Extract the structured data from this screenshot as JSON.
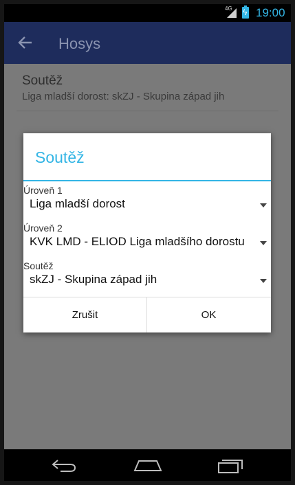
{
  "status_bar": {
    "network": "4G",
    "time": "19:00",
    "icons": [
      "network-signal-icon",
      "battery-charging-icon"
    ]
  },
  "app_bar": {
    "title": "Hosys",
    "back_icon": "arrow-left-icon"
  },
  "preference": {
    "title": "Soutěž",
    "summary": "Liga mladší dorost: skZJ - Skupina západ jih"
  },
  "dialog": {
    "title": "Soutěž",
    "fields": [
      {
        "label": "Úroveň 1",
        "value": "Liga mladší dorost"
      },
      {
        "label": "Úroveň 2",
        "value": "KVK LMD  - ELIOD Liga mladšího dorostu"
      },
      {
        "label": "Soutěž",
        "value": "skZJ - Skupina západ jih"
      }
    ],
    "cancel_label": "Zrušit",
    "ok_label": "OK"
  },
  "nav_bar": {
    "icons": [
      "back-icon",
      "home-icon",
      "recents-icon"
    ]
  },
  "colors": {
    "accent": "#33b5e5",
    "app_bar": "#1e2c5c"
  }
}
